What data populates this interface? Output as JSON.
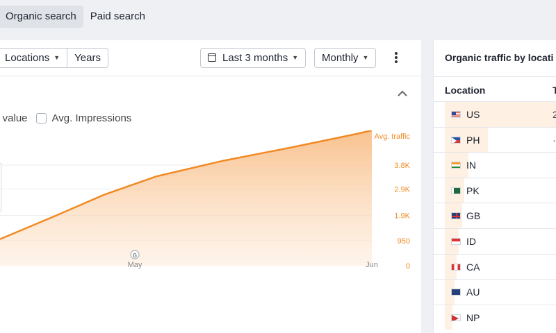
{
  "tabs": [
    {
      "label": "Organic search",
      "active": true
    },
    {
      "label": "Paid search",
      "active": false
    }
  ],
  "toolbar": {
    "segment": [
      "Locations",
      "Years"
    ],
    "date_range": "Last 3 months",
    "granularity": "Monthly"
  },
  "legend": {
    "item1": "c value",
    "item2": "Avg. Impressions"
  },
  "chart_data": {
    "type": "area",
    "title": "",
    "series": [
      {
        "name": "Avg. traffic",
        "color": "#f08a24"
      }
    ],
    "x_ticks": [
      "May",
      "Jun"
    ],
    "y_ticks": [
      "0",
      "950",
      "1.9K",
      "2.9K",
      "3.8K"
    ],
    "ylim": [
      0,
      4500
    ],
    "x": [
      0,
      0.15,
      0.28,
      0.42,
      0.6,
      0.78,
      0.95,
      1.0
    ],
    "y": [
      1900,
      2350,
      2750,
      3100,
      3400,
      3650,
      3900,
      3980
    ],
    "grid": true
  },
  "right": {
    "title": "Organic traffic by locati",
    "col_location": "Location",
    "col_traffic": "T",
    "rows": [
      {
        "code": "US",
        "value": "2",
        "share": 0.58,
        "flag": "us"
      },
      {
        "code": "PH",
        "value": "·",
        "share": 0.22,
        "flag": "ph"
      },
      {
        "code": "IN",
        "value": "",
        "share": 0.12,
        "flag": "in"
      },
      {
        "code": "PK",
        "value": "",
        "share": 0.1,
        "flag": "pk"
      },
      {
        "code": "GB",
        "value": "",
        "share": 0.09,
        "flag": "gb"
      },
      {
        "code": "ID",
        "value": "",
        "share": 0.07,
        "flag": "id"
      },
      {
        "code": "CA",
        "value": "",
        "share": 0.06,
        "flag": "ca"
      },
      {
        "code": "AU",
        "value": "",
        "share": 0.05,
        "flag": "au"
      },
      {
        "code": "NP",
        "value": "",
        "share": 0.04,
        "flag": "np"
      }
    ]
  }
}
